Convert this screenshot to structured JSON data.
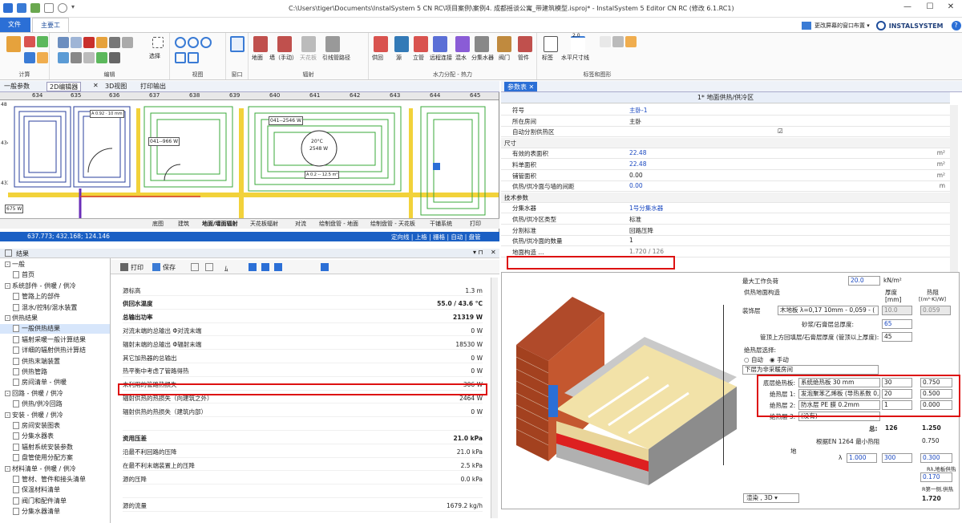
{
  "window": {
    "title": "C:\\Users\\tiger\\Documents\\InstalSystem 5 CN RC\\项目案例\\案例4. 成都摇谈公寓_带建筑模型.isproj* - InstalSystem 5 Editor CN RC (修改 6.1.RC1)",
    "minimize": "—",
    "maximize": "☐",
    "close": "✕"
  },
  "ribbon": {
    "file_tab": "文件",
    "main_tab": "主要工具",
    "right_layout": "更改屏幕的窗口布置 ▾",
    "brand": "INSTALSYSTEM",
    "help": "?",
    "groups": [
      "计算",
      "编辑",
      "视图",
      "窗口",
      "辐射",
      "水力分配 - 热力",
      "标签和图形"
    ],
    "select_label": "选择",
    "radiant_buttons": [
      "地面",
      "墙（手动）",
      "天花板",
      "引线管路径"
    ],
    "hydro_buttons": [
      "供回",
      "源",
      "立管",
      "远程连接",
      "混水",
      "分集水器",
      "阀门",
      "管件"
    ],
    "label_buttons": [
      "标签",
      "水平尺寸线"
    ],
    "dim_value": "2,0"
  },
  "doc_tabs": [
    "一般参数",
    "2D编辑器",
    "3D视图",
    "打印输出"
  ],
  "drawing": {
    "ruler": [
      "634",
      "635",
      "636",
      "637",
      "638",
      "639",
      "640",
      "641",
      "642",
      "643",
      "644",
      "645"
    ],
    "left_ruler": [
      "48",
      "434",
      "433"
    ],
    "zoom": "0",
    "room_labels": [
      "A 0.92 · 10 mm",
      "041--2546 W",
      "20°C",
      "2548 W",
      "041--966 W",
      "A 0.2 -- 12.5 m²",
      "675 W"
    ],
    "bottom_tabs": [
      "底图",
      "建筑",
      "地面/墙面辐射",
      "天花板辐射",
      "对流",
      "绘制盘管 - 地面",
      "绘制盘管 - 天花板",
      "干铺系统",
      "打印"
    ],
    "coords": "637.773; 432.168; 124.146",
    "snap_options": "定向线 | 上格 | 栅格 | 自动 | 盘管"
  },
  "results": {
    "title": "结果",
    "tree": [
      {
        "label": "一般",
        "level": 0,
        "type": "folder",
        "expanded": true
      },
      {
        "label": "首页",
        "level": 1,
        "type": "doc"
      },
      {
        "label": "系统部件 - 供暖 / 供冷",
        "level": 0,
        "type": "folder",
        "expanded": true
      },
      {
        "label": "管路上的部件",
        "level": 1,
        "type": "doc"
      },
      {
        "label": "混水/控制/混水装置",
        "level": 1,
        "type": "doc"
      },
      {
        "label": "供热结果",
        "level": 0,
        "type": "folder",
        "expanded": true
      },
      {
        "label": "一般供热结果",
        "level": 1,
        "type": "doc",
        "selected": true
      },
      {
        "label": "辐射采暖一般计算结果",
        "level": 1,
        "type": "doc"
      },
      {
        "label": "详细的辐射供热计算结",
        "level": 1,
        "type": "doc"
      },
      {
        "label": "供热末端装置",
        "level": 1,
        "type": "doc"
      },
      {
        "label": "供热管路",
        "level": 1,
        "type": "doc"
      },
      {
        "label": "房间清单 - 供暖",
        "level": 1,
        "type": "doc"
      },
      {
        "label": "回路 - 供暖 / 供冷",
        "level": 0,
        "type": "folder",
        "expanded": true
      },
      {
        "label": "供热/供冷回路",
        "level": 1,
        "type": "doc"
      },
      {
        "label": "安装 - 供暖 / 供冷",
        "level": 0,
        "type": "folder",
        "expanded": true
      },
      {
        "label": "房间安装图表",
        "level": 1,
        "type": "doc"
      },
      {
        "label": "分集水器表",
        "level": 1,
        "type": "doc"
      },
      {
        "label": "辐射系统安装参数",
        "level": 1,
        "type": "doc"
      },
      {
        "label": "盘管使用分配方案",
        "level": 1,
        "type": "doc"
      },
      {
        "label": "材料清单 - 供暖 / 供冷",
        "level": 0,
        "type": "folder",
        "expanded": true
      },
      {
        "label": "管材、管件和接头清单",
        "level": 1,
        "type": "doc"
      },
      {
        "label": "保温材料清单",
        "level": 1,
        "type": "doc"
      },
      {
        "label": "阀门和配件清单",
        "level": 1,
        "type": "doc"
      },
      {
        "label": "分集水器清单",
        "level": 1,
        "type": "doc"
      }
    ],
    "toolbar": {
      "print": "打印",
      "save": "保存"
    },
    "report": [
      {
        "k": "源标高",
        "v": "1.3 m",
        "b": false
      },
      {
        "k": "供回水温度",
        "v": "55.0 / 43.6 °C",
        "b": true
      },
      {
        "k": "总输出功率",
        "v": "21319 W",
        "b": true
      },
      {
        "k": "对流末端的总输出 Φ对流末端",
        "v": "0 W",
        "b": false
      },
      {
        "k": "辐射末端的总输出 Φ辐射末端",
        "v": "18530 W",
        "b": false
      },
      {
        "k": "其它加热器的总输出",
        "v": "0 W",
        "b": false
      },
      {
        "k": "热平衡中考虑了管路得热",
        "v": "0 W",
        "b": false
      },
      {
        "k": "未利用的管路热损失",
        "v": "306 W",
        "b": false
      },
      {
        "k": "辐射供热的热损失（向建筑之外）",
        "v": "2464 W",
        "b": false
      },
      {
        "k": "辐射供热的热损失（建筑内部）",
        "v": "0 W",
        "b": false
      },
      {
        "k": "",
        "v": "",
        "b": false
      },
      {
        "k": "资用压差",
        "v": "21.0 kPa",
        "b": true
      },
      {
        "k": "沿最不利回路的压降",
        "v": "21.0 kPa",
        "b": false
      },
      {
        "k": "在最不利末端装置上的压降",
        "v": "2.5 kPa",
        "b": false
      },
      {
        "k": "源的压降",
        "v": "0.0 kPa",
        "b": false
      },
      {
        "k": "",
        "v": "",
        "b": false
      },
      {
        "k": "源的流量",
        "v": "1679.2 kg/h",
        "b": false
      }
    ]
  },
  "params": {
    "tab": "参数表",
    "header": "1* 地面供热/供冷区",
    "rows": [
      {
        "k": "符号",
        "v": "主卧-1",
        "u": "",
        "cls": "blue",
        "sec": false
      },
      {
        "k": "所在房间",
        "v": "主卧",
        "u": "",
        "cls": "",
        "sec": false
      },
      {
        "k": "自动分割供热区",
        "v": "☑",
        "u": "",
        "cls": "",
        "sec": false
      },
      {
        "k": "尺寸",
        "v": "",
        "u": "",
        "cls": "",
        "sec": true
      },
      {
        "k": "有效的表面积",
        "v": "22.48",
        "u": "m²",
        "cls": "blue",
        "sec": false
      },
      {
        "k": "料单面积",
        "v": "22.48",
        "u": "m²",
        "cls": "blue",
        "sec": false
      },
      {
        "k": "铺管面积",
        "v": "0.00",
        "u": "m²",
        "cls": "",
        "sec": false
      },
      {
        "k": "供热/供冷面与墙的间距",
        "v": "0.00",
        "u": "m",
        "cls": "blue",
        "sec": false
      },
      {
        "k": "技术参数",
        "v": "",
        "u": "",
        "cls": "",
        "sec": true
      },
      {
        "k": "分集水器",
        "v": "1号分集水器",
        "u": "",
        "cls": "blue",
        "sec": false
      },
      {
        "k": "供热/供冷区类型",
        "v": "标准",
        "u": "",
        "cls": "",
        "sec": false
      },
      {
        "k": "分割标准",
        "v": "回路压降",
        "u": "",
        "cls": "",
        "sec": false
      },
      {
        "k": "供热/供冷面的数量",
        "v": "1",
        "u": "",
        "cls": "",
        "sec": false
      },
      {
        "k": "地面构造 ...",
        "v": "1.720 / 126",
        "u": "",
        "cls": "gray",
        "sec": false
      }
    ]
  },
  "floor": {
    "max_load_label": "最大工作负荷",
    "max_load": "20.0",
    "max_load_unit": "kN/m²",
    "construction_label": "供热地面构造",
    "col_thickness": "厚度",
    "col_thickness_unit": "[mm]",
    "col_resistance": "热阻",
    "col_resistance_unit": "[(m²·K)/W]",
    "finish_label": "装饰层",
    "finish_value": "木地板 λ=0,17 10mm - 0,059 - (",
    "finish_thk": "10.0",
    "finish_r": "0.059",
    "screed_label": "砂浆/石膏层总厚度:",
    "screed_thk": "65",
    "above_pipe_label": "管顶上方回填层/石膏层厚度 (管顶以上厚度):",
    "above_pipe_thk": "45",
    "ins_select_label": "绝热层选择:",
    "auto": "自动",
    "manual": "手动",
    "below_label": "下层为非采暖房间",
    "base_label": "底层绝热板:",
    "base_value": "系统绝热板 30 mm",
    "base_thk": "30",
    "base_r": "0.750",
    "ins1_label": "绝热层 1:",
    "ins1_value": "发泡聚苯乙烯板 (导热系数 0,",
    "ins1_thk": "20",
    "ins1_r": "0.500",
    "ins2_label": "绝热层 2:",
    "ins2_value": "防水层 PE 膜 0.2mm",
    "ins2_thk": "1",
    "ins2_r": "0.000",
    "ins3_label": "绝热层 3:",
    "ins3_value": "(没有)",
    "total_label": "总:",
    "total_thk": "126",
    "total_r": "1.250",
    "en_label": "根据EN 1264 最小热阻",
    "en_r": "0.750",
    "ground_label": "地",
    "lambda_label": "λ",
    "lambda_value": "1.000",
    "ground_thk": "300",
    "ground_r": "0.300",
    "r_label1": "Rλ,地板供热",
    "r_value1": "0.170",
    "r_label2": "R第一侧,供热",
    "r_value2": "1.720",
    "render_label": "渲染 , 3D"
  }
}
